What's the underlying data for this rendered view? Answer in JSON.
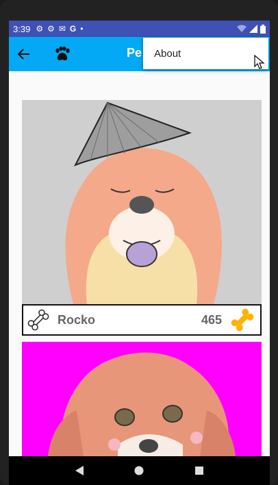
{
  "status": {
    "time": "3:39",
    "left_icons": [
      "gear-icon",
      "gear-icon",
      "gmail-icon",
      "google-icon",
      "dot-icon"
    ],
    "right_icons": [
      "wifi-icon",
      "signal-icon",
      "battery-icon"
    ]
  },
  "appbar": {
    "title": "Pe",
    "back_icon": "arrow-back-icon",
    "logo_icon": "paw-icon",
    "color": "#03a9f4"
  },
  "menu": {
    "items": [
      {
        "label": "About"
      }
    ]
  },
  "pets": [
    {
      "name": "Rocko",
      "score": "465",
      "background": "#cfcfcf"
    },
    {
      "name": "",
      "score": "",
      "background": "#ff00ff"
    }
  ],
  "navbar": {
    "buttons": [
      "back-triangle-icon",
      "home-circle-icon",
      "recents-square-icon"
    ]
  }
}
